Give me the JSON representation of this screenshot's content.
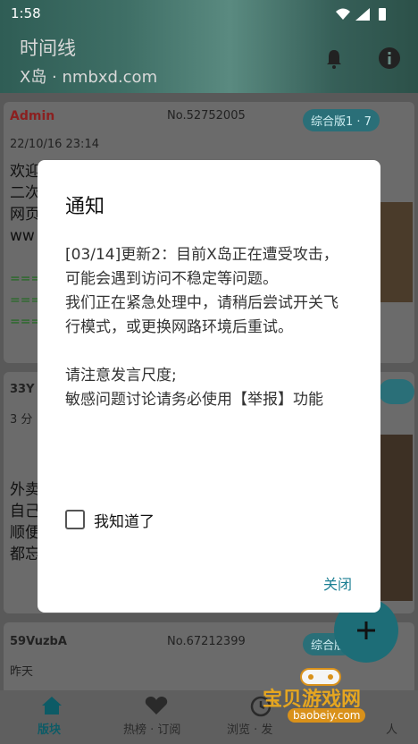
{
  "status": {
    "time": "1:58"
  },
  "header": {
    "title": "时间线",
    "subtitle": "X岛 · nmbxd.com",
    "icons": [
      "bell-icon",
      "info-icon"
    ]
  },
  "posts": [
    {
      "author": "Admin",
      "number": "No.52752005",
      "board": "综合版1 · 7",
      "time": "22/10/16 23:14",
      "lines": [
        "欢迎",
        "二次",
        "网页",
        "ww"
      ],
      "green_lines": [
        "===",
        "===",
        "==="
      ]
    },
    {
      "author": "33Y",
      "time": "3 分",
      "lines": [
        "外卖",
        "自己",
        "顺便",
        "都忘"
      ]
    },
    {
      "author": "59VuzbA",
      "number": "No.67212399",
      "board": "综合版",
      "time": "昨天"
    }
  ],
  "dialog": {
    "title": "通知",
    "body": "[03/14]更新2：目前X岛正在遭受攻击，可能会遇到访问不稳定等问题。\n我们正在紧急处理中，请稍后尝试开关飞行模式，或更换网路环境后重试。\n\n请注意发言尺度;\n敏感问题讨论请务必使用【举报】功能",
    "checkbox_label": "我知道了",
    "checkbox_checked": false,
    "close_label": "关闭"
  },
  "fab": {
    "icon": "plus-icon"
  },
  "nav": {
    "items": [
      {
        "label": "版块",
        "icon": "home-icon",
        "active": true
      },
      {
        "label": "热榜 · 订阅",
        "icon": "heart-icon",
        "active": false
      },
      {
        "label": "浏览 · 发",
        "icon": "history-icon",
        "active": false
      },
      {
        "label": "人",
        "icon": "person-icon",
        "active": false
      }
    ]
  },
  "watermark": {
    "text": "宝贝游戏网",
    "sub": "baobeiy.com"
  },
  "colors": {
    "accent": "#1c7f93",
    "admin": "#8b2020",
    "dialog_bg": "#ffffff"
  }
}
